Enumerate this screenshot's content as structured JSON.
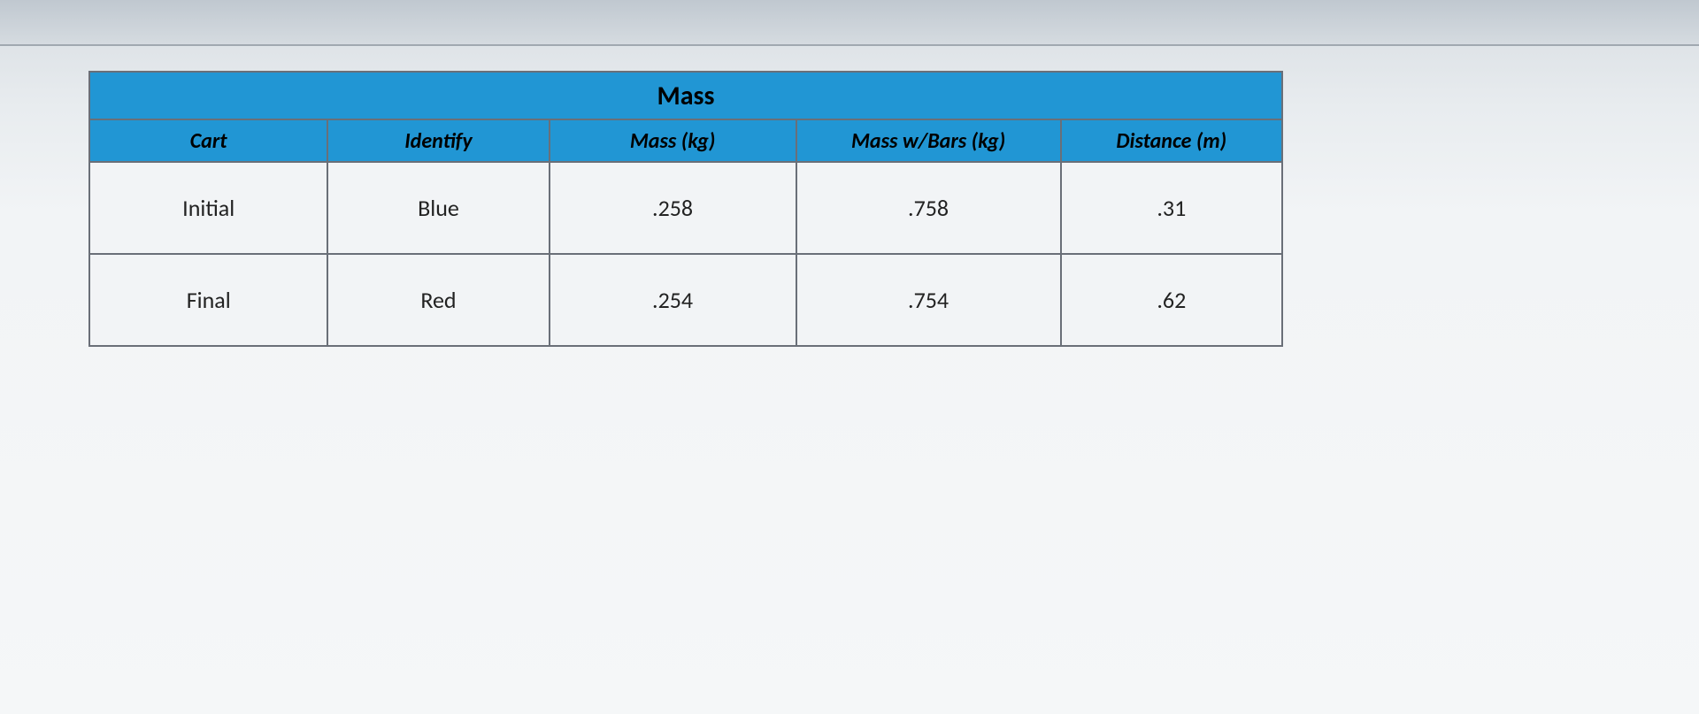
{
  "table": {
    "title": "Mass",
    "headers": {
      "cart": "Cart",
      "identify": "Identify",
      "mass": "Mass (kg)",
      "mass_w_bars": "Mass w/Bars (kg)",
      "distance": "Distance (m)"
    },
    "rows": [
      {
        "cart": "Initial",
        "identify": "Blue",
        "mass": ".258",
        "mass_w_bars": ".758",
        "distance": ".31"
      },
      {
        "cart": "Final",
        "identify": "Red",
        "mass": ".254",
        "mass_w_bars": ".754",
        "distance": ".62"
      }
    ]
  }
}
